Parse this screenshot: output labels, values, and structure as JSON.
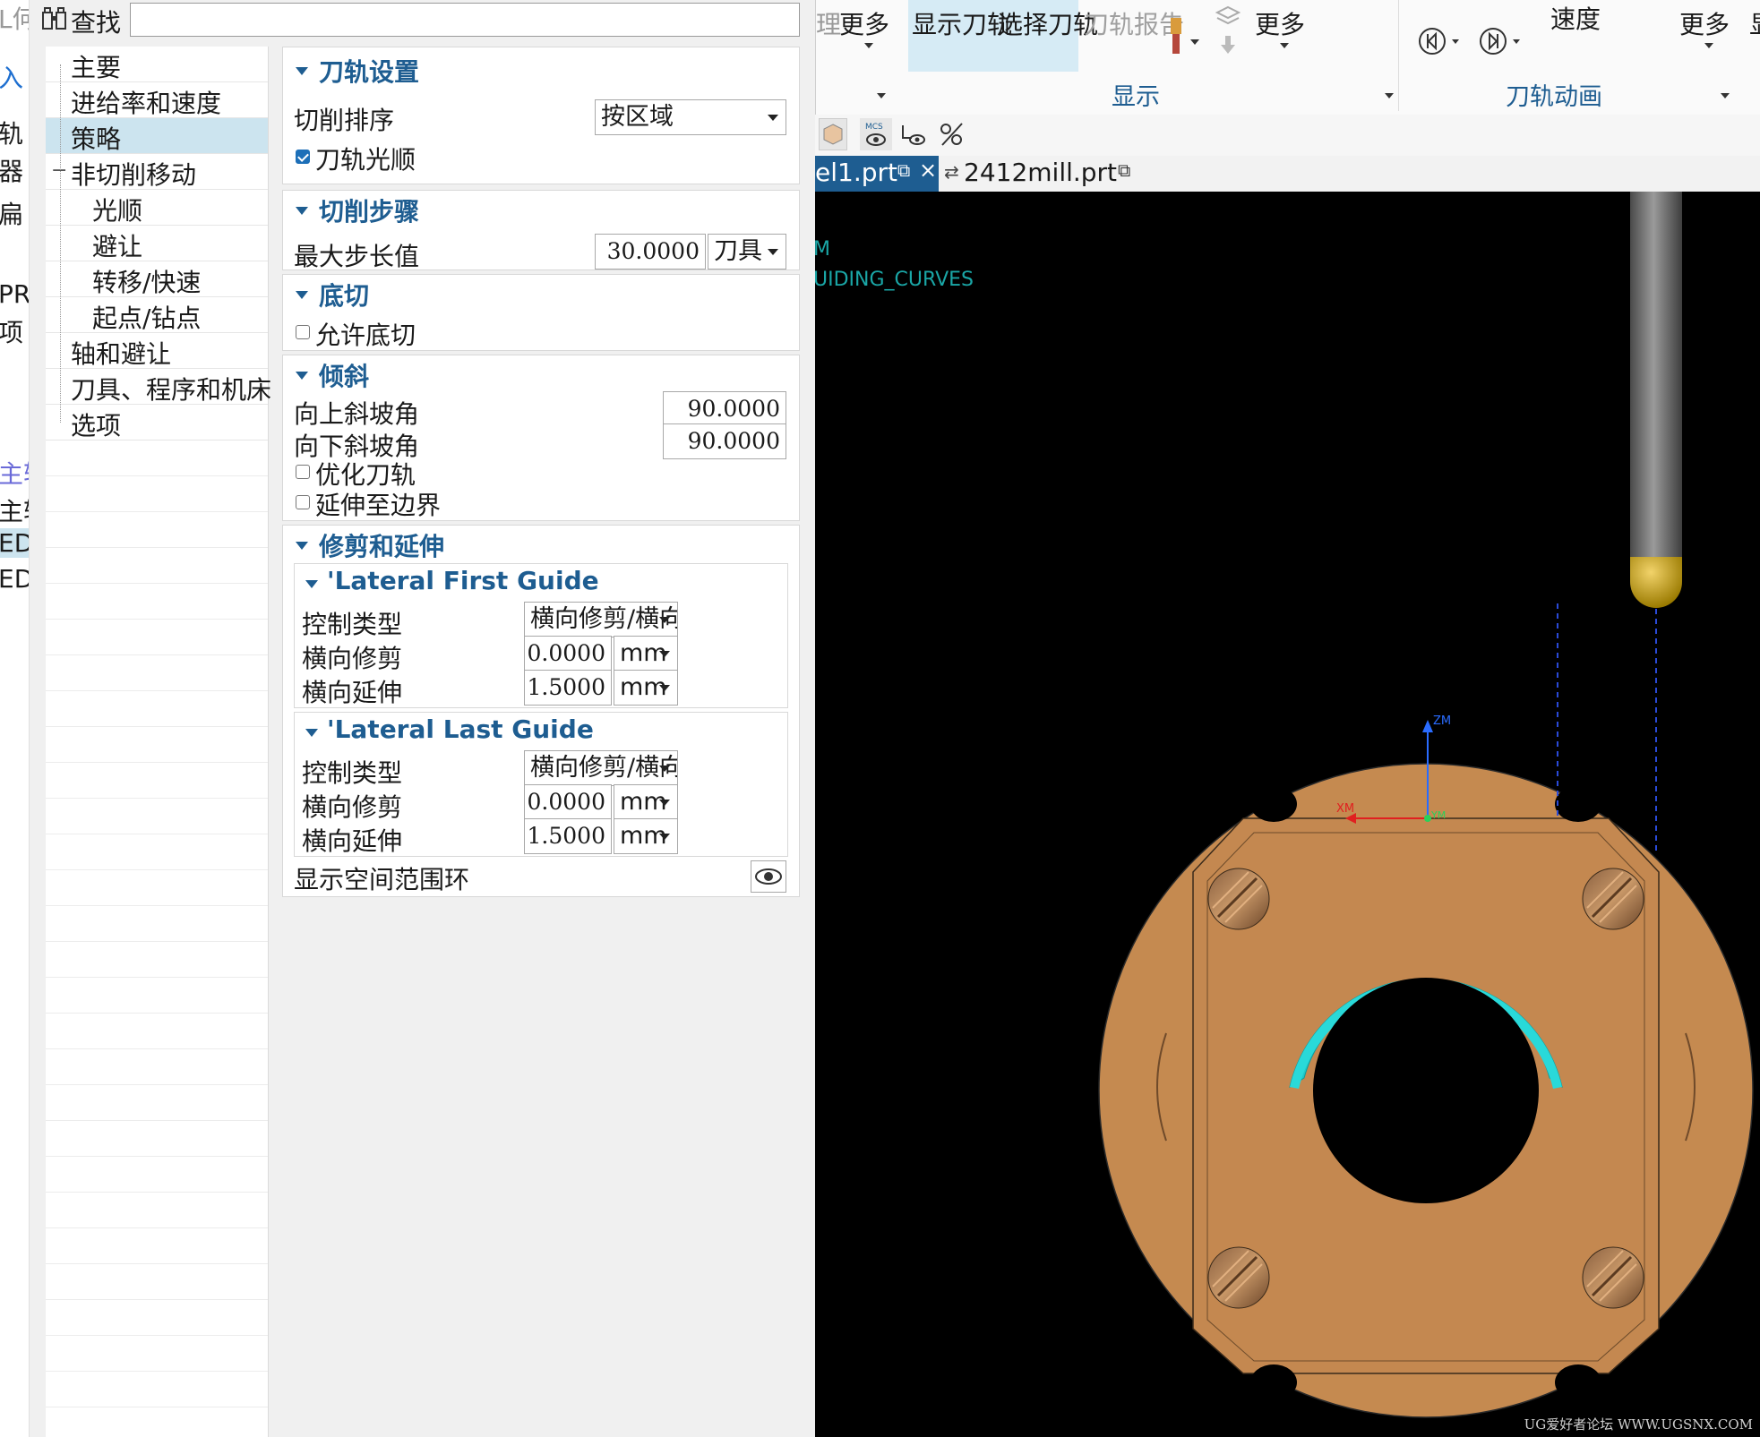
{
  "left_sliver": {
    "items": [
      "L何",
      "入",
      "轨",
      "器",
      "扁",
      "PRO",
      "项",
      "主轴",
      "主轴",
      "ED",
      "ED"
    ]
  },
  "find": {
    "label": "查找",
    "icon": "binoculars-icon",
    "value": ""
  },
  "tree": {
    "items": [
      {
        "label": "主要"
      },
      {
        "label": "进给率和速度"
      },
      {
        "label": "策略",
        "selected": true
      },
      {
        "label": "非切削移动",
        "toggle": "−"
      },
      {
        "label": "光顺"
      },
      {
        "label": "避让"
      },
      {
        "label": "转移/快速"
      },
      {
        "label": "起点/钻点"
      },
      {
        "label": "轴和避让"
      },
      {
        "label": "刀具、程序和机床"
      },
      {
        "label": "选项"
      }
    ]
  },
  "panel": {
    "cut_settings": {
      "title": "刀轨设置",
      "order_label": "切削排序",
      "order_value": "按区域",
      "smooth_label": "刀轨光顺",
      "smooth_checked": true
    },
    "cut_step": {
      "title": "切削步骤",
      "max_step_label": "最大步长值",
      "max_step_value": "30.0000",
      "max_step_unit": "刀具"
    },
    "undercut": {
      "title": "底切",
      "allow_label": "允许底切",
      "allow_checked": false
    },
    "tilt": {
      "title": "倾斜",
      "up_label": "向上斜坡角",
      "up_value": "90.0000",
      "down_label": "向下斜坡角",
      "down_value": "90.0000",
      "optimize_label": "优化刀轨",
      "extend_label": "延伸至边界"
    },
    "trim_extend": {
      "title": "修剪和延伸",
      "first": {
        "title": "'Lateral First Guide",
        "type_label": "控制类型",
        "type_value": "横向修剪/横向延伸",
        "trim_label": "横向修剪",
        "trim_value": "0.0000",
        "trim_unit": "mm",
        "ext_label": "横向延伸",
        "ext_value": "1.5000",
        "ext_unit": "mm"
      },
      "last": {
        "title": "'Lateral Last Guide",
        "type_label": "控制类型",
        "type_value": "横向修剪/横向延伸",
        "trim_label": "横向修剪",
        "trim_value": "0.0000",
        "trim_unit": "mm",
        "ext_label": "横向延伸",
        "ext_value": "1.5000",
        "ext_unit": "mm"
      },
      "show_ring_label": "显示空间范围环"
    }
  },
  "ribbon": {
    "more1": "更多",
    "show_toolpath": "显示刀轨",
    "select_toolpath": "选择刀轨",
    "toolpath_report": "刀轨报告",
    "more2": "更多",
    "speed": "速度",
    "more3": "更多",
    "group_display": "显示",
    "group_animation": "刀轨动画",
    "partial_left": "理",
    "partial_right": "显"
  },
  "tabs": {
    "active": "el1.prt",
    "other": "2412mill.prt"
  },
  "viewport": {
    "overlay_line1": "M",
    "overlay_line2": "UIDING_CURVES",
    "axis_zm": "ZM",
    "axis_xm": "XM",
    "axis_ym": "YM",
    "watermark": "UG爱好者论坛 WWW.UGSNX.COM",
    "colors": {
      "part": "#c58a50",
      "tool": "#7a7a7a",
      "tool_tip": "#c9a000",
      "toolpath": "#1ec8c8"
    }
  }
}
